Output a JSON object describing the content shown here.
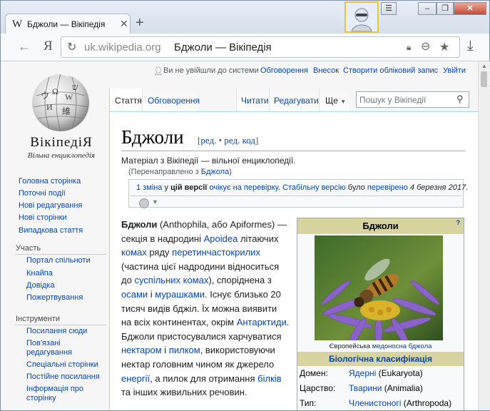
{
  "browser": {
    "tab_title": "Бджоли — Вікіпедія",
    "tab_icon": "W",
    "new_tab": "+",
    "url_domain": "uk.wikipedia.org",
    "url_title": "Бджоли — Вікіпедія",
    "yandex_button": "Я"
  },
  "wiki": {
    "wordmark": "ВікіпедіЯ",
    "tagline": "Вільна енциклопедія",
    "userbar": {
      "not_logged": "Ви не увійшли до системи",
      "talk": "Обговорення",
      "contrib": "Внесок",
      "create": "Створити обліковий запис",
      "login": "Увійти"
    },
    "tabs": {
      "article": "Стаття",
      "talk": "Обговорення",
      "read": "Читати",
      "edit": "Редагувати",
      "more": "Ще"
    },
    "search_placeholder": "Пошук у Вікіпедії",
    "sidebar": {
      "main": [
        "Головна сторінка",
        "Поточні події",
        "Нові редагування",
        "Нові сторінки",
        "Випадкова стаття"
      ],
      "participation_head": "Участь",
      "participation": [
        "Портал спільноти",
        "Кнайпа",
        "Довідка",
        "Пожертвування"
      ],
      "tools_head": "Інструменти",
      "tools": [
        "Посилання сюди",
        "Пов'язані редагування",
        "Спеціальні сторінки",
        "Постійне посилання",
        "Інформація про сторінку"
      ]
    }
  },
  "article": {
    "title": "Бджоли",
    "edit_open": "[",
    "edit_link": "ред.",
    "edit_sep": " • ",
    "edit_code": "ред. код",
    "edit_close": "]",
    "from": "Матеріал з Вікіпедії — вільної енциклопедії.",
    "redirect_prefix": "(Перенаправлено з ",
    "redirect_link": "Бджола",
    "redirect_suffix": ")",
    "flagged": {
      "changes": "1 зміна",
      "t1": " у ",
      "this_version": "цій версії",
      "t2": " ",
      "pending": "очікує на перевірку",
      "t3": ". ",
      "stable": "Стабільну версію",
      "t4": " було ",
      "checked": "перевірено",
      "t5": " ",
      "date": "4 березня 2017",
      "t6": "."
    },
    "lead": [
      {
        "b": "Бджоли"
      },
      {
        "t": " (Anthophila, або Apiformes) — секція в надродині "
      },
      {
        "a": "Apoidea"
      },
      {
        "t": " літаючих "
      },
      {
        "a": "комах"
      },
      {
        "t": " ряду "
      },
      {
        "a": "перетинчастокрилих"
      },
      {
        "t": " (частина цієї надродини відноситься до "
      },
      {
        "a": "суспільних комах"
      },
      {
        "t": "), споріднена з "
      },
      {
        "a": "осами"
      },
      {
        "t": " і "
      },
      {
        "a": "мурашками"
      },
      {
        "t": ". Існує близько 20 тисяч видів бджіл. Їх можна виявити на всіх континентах, окрім "
      },
      {
        "a": "Антарктиди"
      },
      {
        "t": ". Бджоли пристосувалися харчуватися "
      },
      {
        "a": "нектаром"
      },
      {
        "t": " і "
      },
      {
        "a": "пилком"
      },
      {
        "t": ", використовуючи нектар головним чином як джерело "
      },
      {
        "a": "енергії"
      },
      {
        "t": ", а пилок для отримання "
      },
      {
        "a": "білків"
      },
      {
        "t": " та інших живильних речовин."
      }
    ],
    "infobox": {
      "title": "Бджоли",
      "help": "?",
      "caption_prefix": "Європейська ",
      "caption_link": "медоносна бджола",
      "classification": "Біологічна класифікація",
      "rows": [
        {
          "k": "Домен:",
          "link": "Ядерні",
          "latin": " (Eukaryota)"
        },
        {
          "k": "Царство:",
          "link": "Тварини",
          "latin": " (Animalia)"
        },
        {
          "k": "Тип:",
          "link": "Членистоногі",
          "latin": " (Arthropoda)"
        }
      ]
    }
  }
}
